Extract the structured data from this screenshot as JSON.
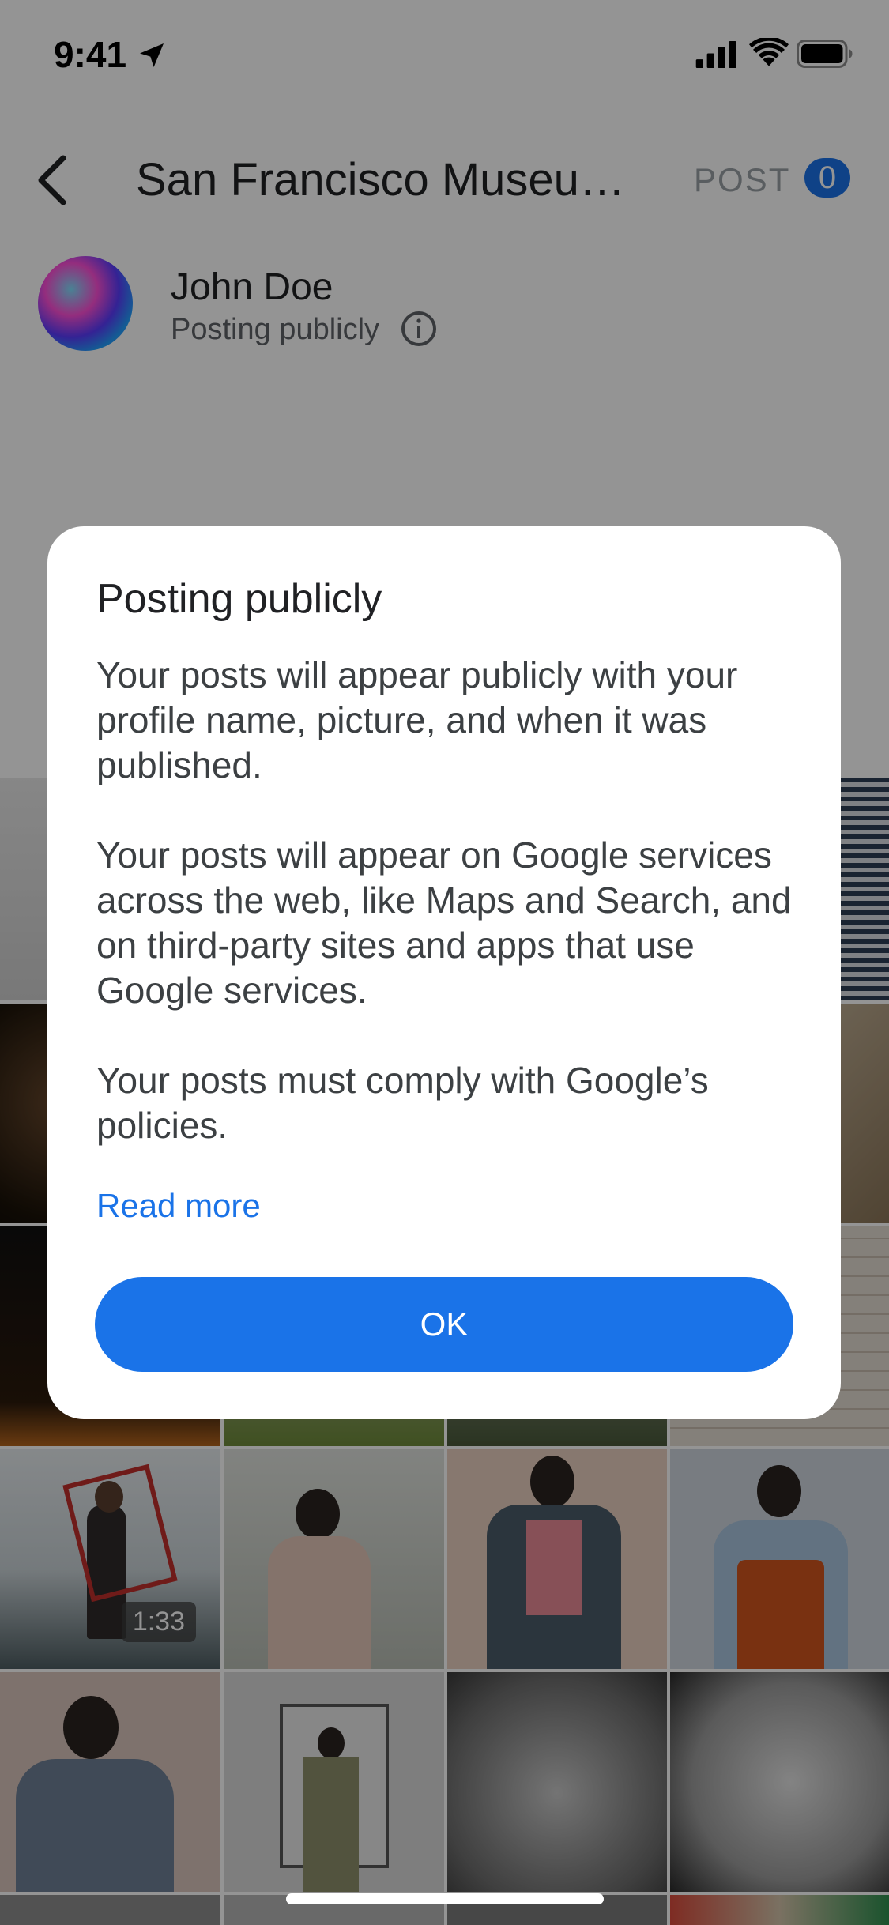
{
  "status_bar": {
    "time": "9:41"
  },
  "header": {
    "title": "San Francisco Museum…",
    "post_label": "POST",
    "selected_count": "0"
  },
  "profile": {
    "name": "John Doe",
    "posting_status": "Posting publicly"
  },
  "grid": {
    "video_duration": "1:33"
  },
  "dialog": {
    "title": "Posting publicly",
    "paragraphs": [
      "Your posts will appear publicly with your profile name, picture, and when it was published.",
      "Your posts will appear on Google services across the web, like Maps and Search, and on third-party sites and apps that use Google services.",
      "Your posts must comply with Google’s policies."
    ],
    "read_more": "Read more",
    "ok_label": "OK"
  },
  "colors": {
    "accent": "#1a73e8",
    "scrim": "rgba(0,0,0,0.42)"
  }
}
